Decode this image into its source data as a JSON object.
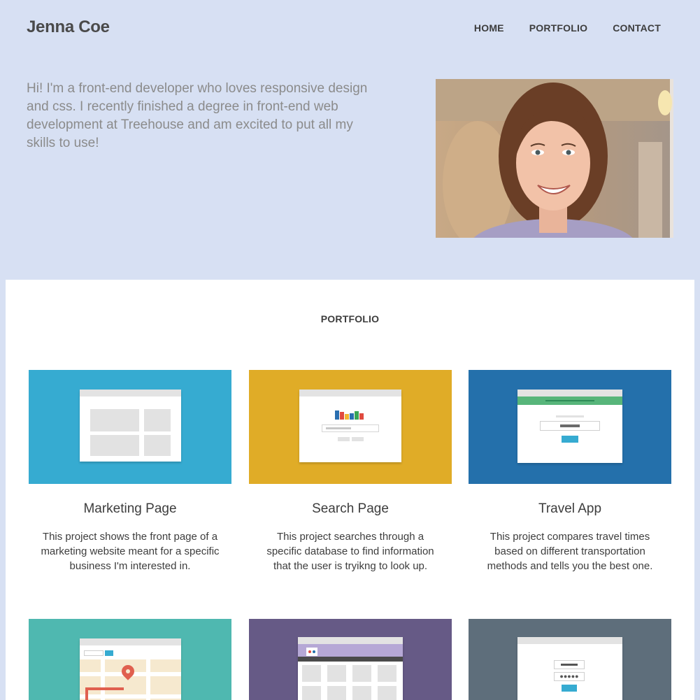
{
  "header": {
    "brand": "Jenna Coe",
    "nav": [
      "HOME",
      "PORTFOLIO",
      "CONTACT"
    ]
  },
  "intro": {
    "text": "Hi! I'm a front-end developer who loves responsive design and css. I recently finished a degree in front-end web development at Treehouse and am excited to put all my skills to use!"
  },
  "portfolio": {
    "title": "PORTFOLIO",
    "projects": [
      {
        "title": "Marketing Page",
        "desc": "This project shows the front page of a marketing website meant for a specific business I'm interested in.",
        "color": "#36abd1"
      },
      {
        "title": "Search Page",
        "desc": "This project searches through a specific database to find information that the user is tryikng to look up.",
        "color": "#e0ac27"
      },
      {
        "title": "Travel App",
        "desc": "This project compares travel times based on different transportation methods and tells you the best one.",
        "color": "#2470ab"
      },
      {
        "title": "",
        "desc": "",
        "color": "#4fb8b0"
      },
      {
        "title": "",
        "desc": "",
        "color": "#665a86"
      },
      {
        "title": "",
        "desc": "",
        "color": "#5e6e7b"
      }
    ]
  },
  "colors": {
    "page_background": "#d7e0f3",
    "panel_background": "#ffffff"
  },
  "icons": [
    "map-pin-icon",
    "browser-window-icon",
    "password-dots-icon"
  ]
}
